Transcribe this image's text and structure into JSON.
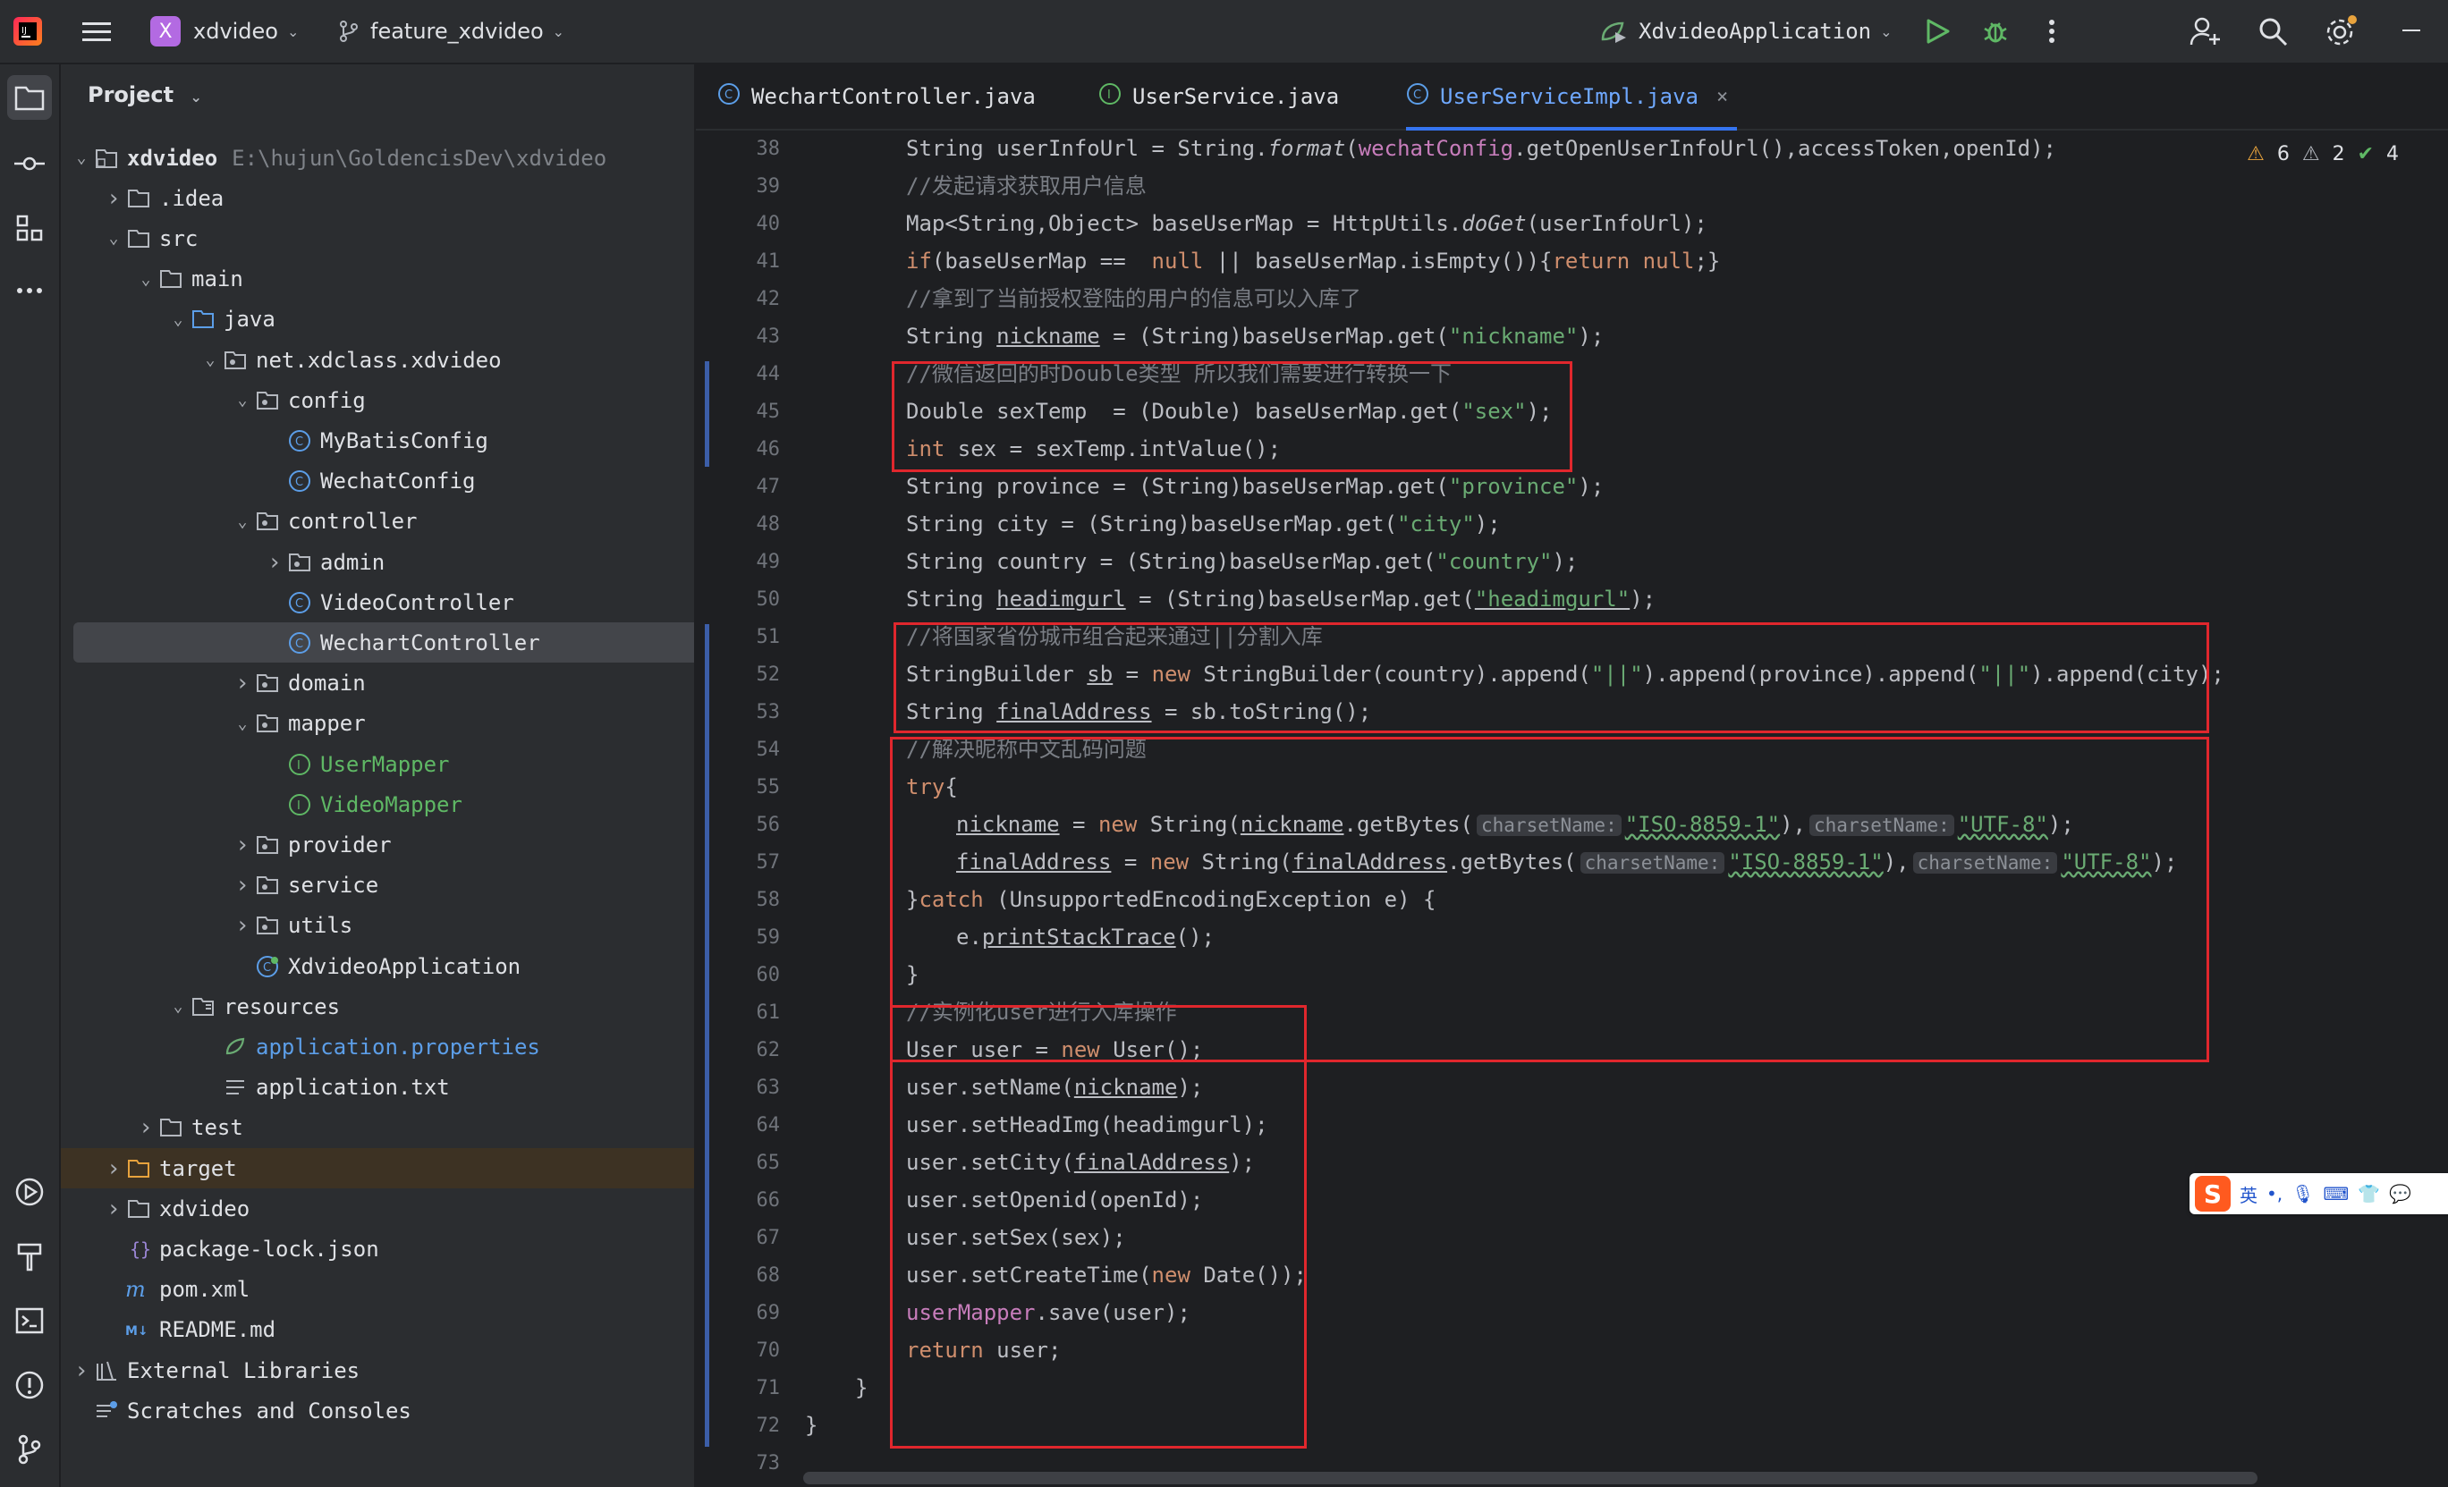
{
  "titlebar": {
    "project_name": "xdvideo",
    "project_badge": "X",
    "branch": "feature_xdvideo",
    "run_config": "XdvideoApplication"
  },
  "project_panel": {
    "header": "Project",
    "root_path": "E:\\hujun\\GoldencisDev\\xdvideo",
    "tree": [
      {
        "label": "xdvideo",
        "depth": 0,
        "arrow": "open",
        "icon": "module"
      },
      {
        "label": ".idea",
        "depth": 1,
        "arrow": "closed",
        "icon": "folder"
      },
      {
        "label": "src",
        "depth": 1,
        "arrow": "open",
        "icon": "folder"
      },
      {
        "label": "main",
        "depth": 2,
        "arrow": "open",
        "icon": "folder"
      },
      {
        "label": "java",
        "depth": 3,
        "arrow": "open",
        "icon": "source-folder"
      },
      {
        "label": "net.xdclass.xdvideo",
        "depth": 4,
        "arrow": "open",
        "icon": "package"
      },
      {
        "label": "config",
        "depth": 5,
        "arrow": "open",
        "icon": "package"
      },
      {
        "label": "MyBatisConfig",
        "depth": 6,
        "arrow": "none",
        "icon": "class"
      },
      {
        "label": "WechatConfig",
        "depth": 6,
        "arrow": "none",
        "icon": "class"
      },
      {
        "label": "controller",
        "depth": 5,
        "arrow": "open",
        "icon": "package"
      },
      {
        "label": "admin",
        "depth": 6,
        "arrow": "closed",
        "icon": "package"
      },
      {
        "label": "VideoController",
        "depth": 6,
        "arrow": "none",
        "icon": "class"
      },
      {
        "label": "WechartController",
        "depth": 6,
        "arrow": "none",
        "icon": "class"
      },
      {
        "label": "domain",
        "depth": 5,
        "arrow": "closed",
        "icon": "package"
      },
      {
        "label": "mapper",
        "depth": 5,
        "arrow": "open",
        "icon": "package"
      },
      {
        "label": "UserMapper",
        "depth": 6,
        "arrow": "none",
        "icon": "interface"
      },
      {
        "label": "VideoMapper",
        "depth": 6,
        "arrow": "none",
        "icon": "interface"
      },
      {
        "label": "provider",
        "depth": 5,
        "arrow": "closed",
        "icon": "package"
      },
      {
        "label": "service",
        "depth": 5,
        "arrow": "closed",
        "icon": "package"
      },
      {
        "label": "utils",
        "depth": 5,
        "arrow": "closed",
        "icon": "package"
      },
      {
        "label": "XdvideoApplication",
        "depth": 5,
        "arrow": "none",
        "icon": "spring-class"
      },
      {
        "label": "resources",
        "depth": 3,
        "arrow": "open",
        "icon": "resources-folder"
      },
      {
        "label": "application.properties",
        "depth": 4,
        "arrow": "none",
        "icon": "properties"
      },
      {
        "label": "application.txt",
        "depth": 4,
        "arrow": "none",
        "icon": "text"
      },
      {
        "label": "test",
        "depth": 2,
        "arrow": "closed",
        "icon": "folder"
      },
      {
        "label": "target",
        "depth": 1,
        "arrow": "closed",
        "icon": "target-folder"
      },
      {
        "label": "xdvideo",
        "depth": 1,
        "arrow": "closed",
        "icon": "folder"
      },
      {
        "label": "package-lock.json",
        "depth": 1,
        "arrow": "none",
        "icon": "json"
      },
      {
        "label": "pom.xml",
        "depth": 1,
        "arrow": "none",
        "icon": "maven"
      },
      {
        "label": "README.md",
        "depth": 1,
        "arrow": "none",
        "icon": "markdown"
      },
      {
        "label": "External Libraries",
        "depth": 0,
        "arrow": "closed",
        "icon": "libraries"
      },
      {
        "label": "Scratches and Consoles",
        "depth": 0,
        "arrow": "none",
        "icon": "scratches"
      }
    ]
  },
  "tabs": [
    {
      "label": "WechartController.java",
      "icon": "class"
    },
    {
      "label": "UserService.java",
      "icon": "interface"
    },
    {
      "label": "UserServiceImpl.java",
      "icon": "class",
      "active": true
    }
  ],
  "inspections": {
    "warnings": "6",
    "weak_warnings": "2",
    "ok": "4"
  },
  "line_numbers": [
    "38",
    "39",
    "40",
    "41",
    "42",
    "43",
    "44",
    "45",
    "46",
    "47",
    "48",
    "49",
    "50",
    "51",
    "52",
    "53",
    "54",
    "55",
    "56",
    "57",
    "58",
    "59",
    "60",
    "61",
    "62",
    "63",
    "64",
    "65",
    "66",
    "67",
    "68",
    "69",
    "70",
    "71",
    "72",
    "73"
  ],
  "code": {
    "l38": {
      "a": "String userInfoUrl = String.",
      "fmt": "format",
      "b": "(",
      "cfg": "wechatConfig",
      "c": ".getOpenUserInfoUrl(),accessToken,openId);"
    },
    "l39": "//发起请求获取用户信息",
    "l40": {
      "a": "Map<String,Object> baseUserMap = HttpUtils.",
      "fn": "doGet",
      "b": "(userInfoUrl);"
    },
    "l41": {
      "kw_if": "if",
      "a": "(baseUserMap ==  ",
      "kw_null": "null",
      "b": " || baseUserMap.isEmpty()){",
      "kw_return": "return",
      "kw_null2": "null",
      "c": ";}"
    },
    "l42": "//拿到了当前授权登陆的用户的信息可以入库了",
    "l43": {
      "a": "String ",
      "var": "nickname",
      "b": " = (String)baseUserMap.get(",
      "str": "\"nickname\"",
      "c": ");"
    },
    "l44": "//微信返回的时Double类型 所以我们需要进行转换一下",
    "l45": {
      "a": "Double sexTemp  = (Double) baseUserMap.get(",
      "str": "\"sex\"",
      "c": ");"
    },
    "l46": {
      "kw": "int",
      "a": " sex = sexTemp.intValue();"
    },
    "l47": {
      "a": "String province = (String)baseUserMap.get(",
      "str": "\"province\"",
      "c": ");"
    },
    "l48": {
      "a": "String city = (String)baseUserMap.get(",
      "str": "\"city\"",
      "c": ");"
    },
    "l49": {
      "a": "String country = (String)baseUserMap.get(",
      "str": "\"country\"",
      "c": ");"
    },
    "l50": {
      "a": "String ",
      "var": "headimgurl",
      "b": " = (String)baseUserMap.get(",
      "str": "\"headimgurl\"",
      "c": ");"
    },
    "l51": "//将国家省份城市组合起来通过||分割入库",
    "l52": {
      "a": "StringBuilder ",
      "var": "sb",
      "b": " = ",
      "kw": "new",
      "c": " StringBuilder(country).append(",
      "s1": "\"||\"",
      "d": ").append(province).append(",
      "s2": "\"||\"",
      "e": ").append(city);"
    },
    "l53": {
      "a": "String ",
      "var": "finalAddress",
      "b": " = sb.toString();"
    },
    "l54": "//解决昵称中文乱码问题",
    "l55": {
      "kw": "try",
      "a": "{"
    },
    "l56": {
      "var": "nickname",
      "a": " = ",
      "kw": "new",
      "b": " String(",
      "var2": "nickname",
      "c": ".getBytes(",
      "hint1": "charsetName:",
      "s1": "\"ISO-8859-1\"",
      "d": "),",
      "hint2": "charsetName:",
      "s2": "\"UTF-8\"",
      "e": ");"
    },
    "l57": {
      "var": "finalAddress",
      "a": " = ",
      "kw": "new",
      "b": " String(",
      "var2": "finalAddress",
      "c": ".getBytes(",
      "hint1": "charsetName:",
      "s1": "\"ISO-8859-1\"",
      "d": "),",
      "hint2": "charsetName:",
      "s2": "\"UTF-8\"",
      "e": ");"
    },
    "l58": {
      "a": "}",
      "kw": "catch",
      "b": " (UnsupportedEncodingException e) {"
    },
    "l59": {
      "a": "e.",
      "fn": "printStackTrace",
      "b": "();"
    },
    "l60": "}",
    "l61": "//实例化user进行入库操作",
    "l62": {
      "a": "User user = ",
      "kw": "new",
      "b": " User();"
    },
    "l63": {
      "a": "user.setName(",
      "var": "nickname",
      "b": ");"
    },
    "l64": "user.setHeadImg(headimgurl);",
    "l65": {
      "a": "user.setCity(",
      "var": "finalAddress",
      "b": ");"
    },
    "l66": "user.setOpenid(openId);",
    "l67": "user.setSex(sex);",
    "l68": {
      "a": "user.setCreateTime(",
      "kw": "new",
      "b": " Date());"
    },
    "l69": {
      "field": "userMapper",
      "a": ".save(user);"
    },
    "l70": {
      "kw": "return",
      "a": " user;"
    },
    "l71": "}",
    "l72": "}"
  },
  "ime_toolbar": {
    "lang": "英",
    "punct": "•,"
  },
  "colors": {
    "keyword": "#cf8e6d",
    "string": "#6aab73",
    "comment": "#7a7e85",
    "field": "#c77dbb",
    "accent": "#3574f0",
    "highlight_box": "#e0272d"
  }
}
